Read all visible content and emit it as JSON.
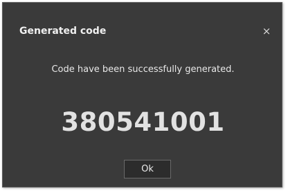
{
  "dialog": {
    "title": "Generated code",
    "close_glyph": "×",
    "close_icon": "close-icon",
    "message": "Code have been successfully generated.",
    "code": "380541001",
    "ok_label": "Ok"
  },
  "colors": {
    "dialog_background": "#3a3a3a",
    "dialog_border": "#5c5c5c",
    "text": "#e6e6e6",
    "button_background": "#2c2c2c",
    "button_border": "#6a6a6a"
  }
}
